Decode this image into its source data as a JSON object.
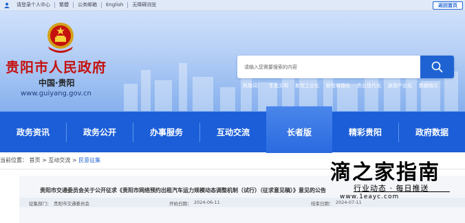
{
  "topbar": {
    "links": [
      "请登录个人中心",
      "繁體",
      "公务邮箱",
      "English",
      "无障碍浏览"
    ],
    "back_button": "返回首页"
  },
  "header": {
    "title": "贵阳市人民政府",
    "subtitle": "中国·贵阳",
    "url": "www.guiyang.gov.cn"
  },
  "search": {
    "placeholder": "请输入您需要搜索的内容",
    "hot_words": [
      "热搜词：",
      "生态文明",
      "新型工业化",
      "新型城镇化",
      "农业现代化",
      "旅游产业化",
      "数据指引"
    ]
  },
  "nav": {
    "items": [
      "政务资讯",
      "政务公开",
      "办事服务",
      "互动交流",
      "长者版",
      "精彩贵阳",
      "政府数据"
    ],
    "active": "长者版"
  },
  "breadcrumb": {
    "prefix": "当前位置：",
    "items": [
      "首页",
      "互动交流",
      "民意征集"
    ],
    "separator": ">"
  },
  "article": {
    "title": "贵阳市交通委员会关于公开征求《贵阳市网络预约出租汽车运力规模动态调整机制（试行）（征求意见稿）》意见的公告",
    "department_label": "征集部门：",
    "department": "贵阳市交通委员会",
    "start_label": "开始日期：",
    "start_date": "2024-06-11",
    "end_label": "结束日期：",
    "end_date": "2024-07-11"
  },
  "watermark": {
    "main": "滴之家指南",
    "sub": "行业动态 · 每日推送",
    "url": "www.1eayc.com"
  },
  "colors": {
    "primary_blue": "#1b5ed8",
    "title_red": "#c5120f",
    "search_button": "#1f63d3"
  }
}
